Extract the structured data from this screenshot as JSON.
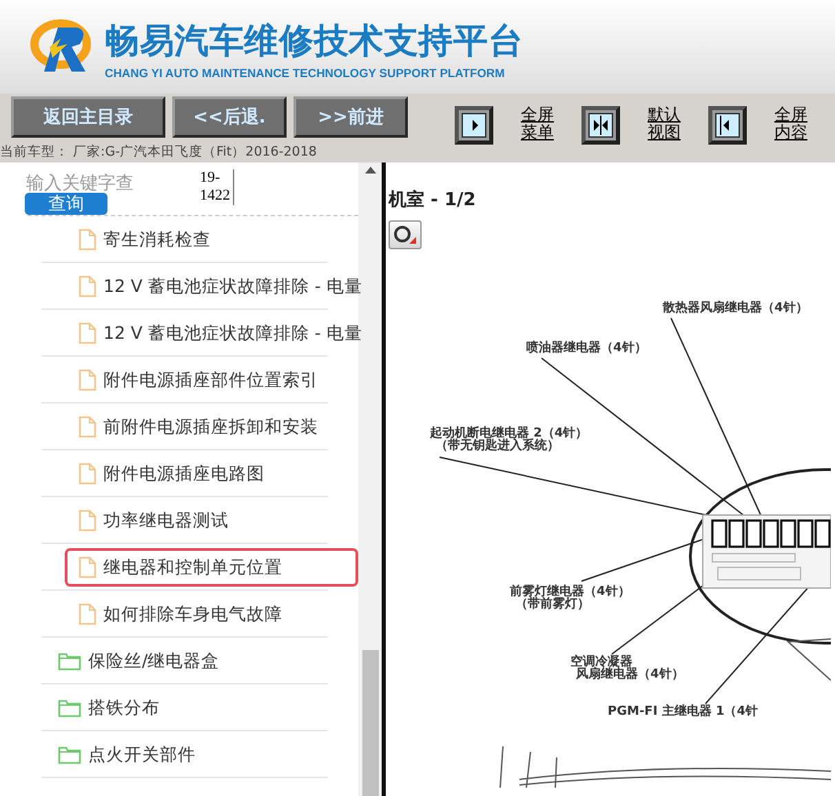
{
  "header": {
    "title": "畅易汽车维修技术支持平台",
    "subtitle": "CHANG YI AUTO MAINTENANCE TECHNOLOGY SUPPORT PLATFORM"
  },
  "toolbar": {
    "nav_buttons": [
      "返回主目录",
      "<<后退.",
      ">>前进"
    ],
    "view_buttons": [
      {
        "kind": "right",
        "label": [
          "全屏",
          "菜单"
        ]
      },
      {
        "kind": "both",
        "label": [
          "默认",
          "视图"
        ]
      },
      {
        "kind": "left",
        "label": [
          "全屏",
          "内容"
        ]
      }
    ],
    "vehicle": "当前车型： 厂家:G-广汽本田飞度（Fit）2016-2018"
  },
  "search": {
    "placeholder": "输入关键字查",
    "code": [
      "19-",
      "1422"
    ],
    "button": "查询"
  },
  "tree": [
    {
      "children": [
        {
          "kind": "file",
          "label": "寄生消耗检查",
          "selected": false
        },
        {
          "kind": "file",
          "label": "12 V 蓄电池症状故障排除 - 电量",
          "selected": false
        },
        {
          "kind": "file",
          "label": "12 V 蓄电池症状故障排除 - 电量",
          "selected": false
        },
        {
          "kind": "file",
          "label": "附件电源插座部件位置索引",
          "selected": false
        },
        {
          "kind": "file",
          "label": "前附件电源插座拆卸和安装",
          "selected": false
        },
        {
          "kind": "file",
          "label": "附件电源插座电路图",
          "selected": false
        },
        {
          "kind": "file",
          "label": "功率继电器测试",
          "selected": false
        },
        {
          "kind": "file",
          "label": "继电器和控制单元位置",
          "selected": true
        },
        {
          "kind": "file",
          "label": "如何排除车身电气故障",
          "selected": false
        }
      ]
    },
    {
      "kind": "folder",
      "label": "保险丝/继电器盒",
      "selected": false
    },
    {
      "kind": "folder",
      "label": "搭铁分布",
      "selected": false
    },
    {
      "kind": "folder",
      "label": "点火开关部件",
      "selected": false
    }
  ],
  "content": {
    "title": "机室 - 1/2",
    "callouts": [
      {
        "lines": [
          "散热器风扇继电器（4针）"
        ]
      },
      {
        "lines": [
          "喷油器继电器（4针）"
        ]
      },
      {
        "lines": [
          "起动机断电继电器 2（4针）",
          "（带无钥匙进入系统）"
        ]
      },
      {
        "lines": [
          "前雾灯继电器（4针）",
          "（带前雾灯）"
        ]
      },
      {
        "lines": [
          "空调冷凝器",
          "风扇继电器（4针）"
        ]
      },
      {
        "lines": [
          "PGM-FI 主继电器 1（4针"
        ]
      }
    ]
  }
}
